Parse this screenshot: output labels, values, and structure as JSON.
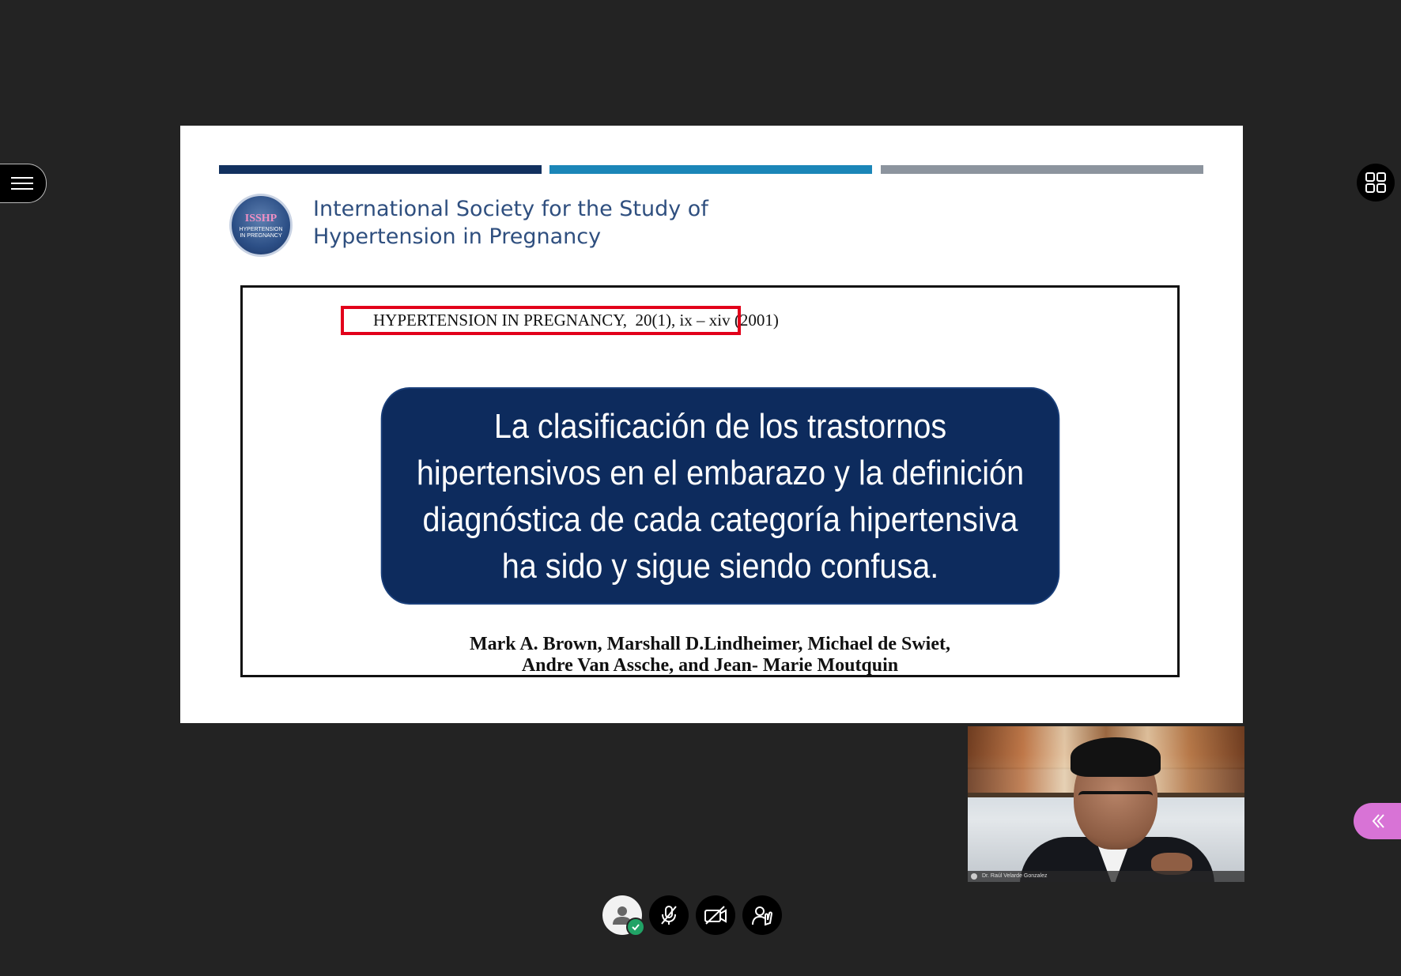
{
  "slide": {
    "org_title_line1": "International Society for the Study of",
    "org_title_line2": "Hypertension in Pregnancy",
    "logo_mark": "ISSHP",
    "logo_text_line1": "HYPERTENSION",
    "logo_text_line2": "IN PREGNANCY",
    "citation": "HYPERTENSION IN PREGNANCY,  20(1), ix – xiv (2001)",
    "quote": "La clasificación de los trastornos hipertensivos en el embarazo y la definición diagnóstica de cada categoría hipertensiva ha sido y sigue siendo confusa.",
    "authors_line1": "Mark A. Brown, Marshall D.Lindheimer, Michael de Swiet,",
    "authors_line2": "Andre Van Assche, and Jean- Marie Moutquin",
    "colors": {
      "bar1": "#12315f",
      "bar2": "#1b86b8",
      "bar3": "#8c949e",
      "quote_bg": "#0d2b5d",
      "highlight_box": "#e2001a"
    }
  },
  "video_tile": {
    "participant_label": "Dr. Raúl Velarde Gonzalez"
  },
  "controls": {
    "icons": [
      "user-status-icon",
      "mic-off-icon",
      "camera-off-icon",
      "raise-hand-icon"
    ],
    "status_color": "#21a366"
  },
  "sidebar_toggle_color": "#d873d6"
}
